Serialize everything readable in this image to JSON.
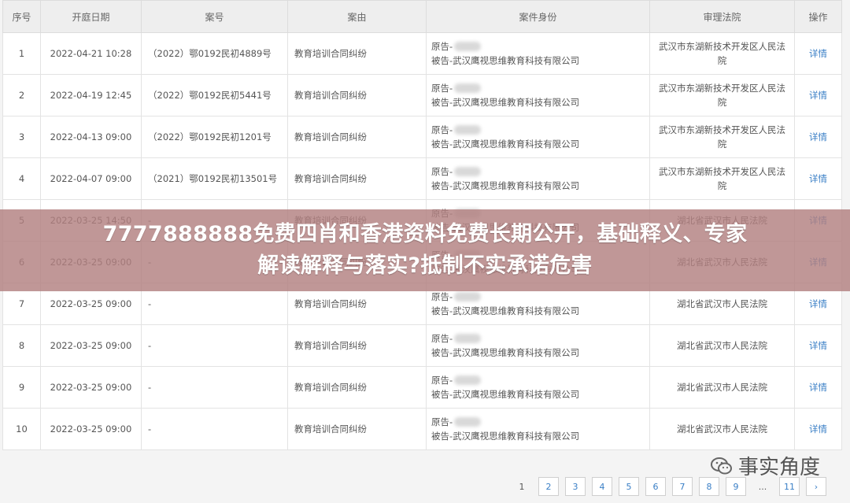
{
  "table": {
    "headers": [
      "序号",
      "开庭日期",
      "案号",
      "案由",
      "案件身份",
      "审理法院",
      "操作"
    ],
    "rows": [
      {
        "idx": "1",
        "date": "2022-04-21 10:28",
        "case_no": "（2022）鄂0192民初4889号",
        "cause": "教育培训合同纠纷",
        "plaintiff": "原告-",
        "defendant": "被告-武汉鹰视思维教育科技有限公司",
        "court": "武汉市东湖新技术开发区人民法院",
        "op": "详情"
      },
      {
        "idx": "2",
        "date": "2022-04-19 12:45",
        "case_no": "（2022）鄂0192民初5441号",
        "cause": "教育培训合同纠纷",
        "plaintiff": "原告-",
        "defendant": "被告-武汉鹰视思维教育科技有限公司",
        "court": "武汉市东湖新技术开发区人民法院",
        "op": "详情"
      },
      {
        "idx": "3",
        "date": "2022-04-13 09:00",
        "case_no": "（2022）鄂0192民初1201号",
        "cause": "教育培训合同纠纷",
        "plaintiff": "原告-",
        "defendant": "被告-武汉鹰视思维教育科技有限公司",
        "court": "武汉市东湖新技术开发区人民法院",
        "op": "详情"
      },
      {
        "idx": "4",
        "date": "2022-04-07 09:00",
        "case_no": "（2021）鄂0192民初13501号",
        "cause": "教育培训合同纠纷",
        "plaintiff": "原告-",
        "defendant": "被告-武汉鹰视思维教育科技有限公司",
        "court": "武汉市东湖新技术开发区人民法院",
        "op": "详情"
      },
      {
        "idx": "5",
        "date": "2022-03-25 14:50",
        "case_no": "-",
        "cause": "教育培训合同纠纷",
        "plaintiff": "原告-",
        "defendant": "被告-武汉鹰视思维教育科技有限公司",
        "court": "湖北省武汉市人民法院",
        "op": "详情"
      },
      {
        "idx": "6",
        "date": "2022-03-25 09:00",
        "case_no": "-",
        "cause": "教育培训合同纠纷",
        "plaintiff": "原告-",
        "defendant": "被告-武汉鹰视思维教育科技有限公司",
        "court": "湖北省武汉市人民法院",
        "op": "详情"
      },
      {
        "idx": "7",
        "date": "2022-03-25 09:00",
        "case_no": "-",
        "cause": "教育培训合同纠纷",
        "plaintiff": "原告-",
        "defendant": "被告-武汉鹰视思维教育科技有限公司",
        "court": "湖北省武汉市人民法院",
        "op": "详情"
      },
      {
        "idx": "8",
        "date": "2022-03-25 09:00",
        "case_no": "-",
        "cause": "教育培训合同纠纷",
        "plaintiff": "原告-",
        "defendant": "被告-武汉鹰视思维教育科技有限公司",
        "court": "湖北省武汉市人民法院",
        "op": "详情"
      },
      {
        "idx": "9",
        "date": "2022-03-25 09:00",
        "case_no": "-",
        "cause": "教育培训合同纠纷",
        "plaintiff": "原告-",
        "defendant": "被告-武汉鹰视思维教育科技有限公司",
        "court": "湖北省武汉市人民法院",
        "op": "详情"
      },
      {
        "idx": "10",
        "date": "2022-03-25 09:00",
        "case_no": "-",
        "cause": "教育培训合同纠纷",
        "plaintiff": "原告-",
        "defendant": "被告-武汉鹰视思维教育科技有限公司",
        "court": "湖北省武汉市人民法院",
        "op": "详情"
      }
    ]
  },
  "banner": {
    "line1": "7777888888免费四肖和香港资料免费长期公开，基础释义、专家",
    "line2": "解读解释与落实?抵制不实承诺危害"
  },
  "pagination": {
    "pages": [
      "1",
      "2",
      "3",
      "4",
      "5",
      "6",
      "7",
      "8",
      "9",
      "...",
      "11",
      "›"
    ],
    "current": "1"
  },
  "watermark": {
    "text": "事实角度",
    "icon": "wechat-icon"
  }
}
